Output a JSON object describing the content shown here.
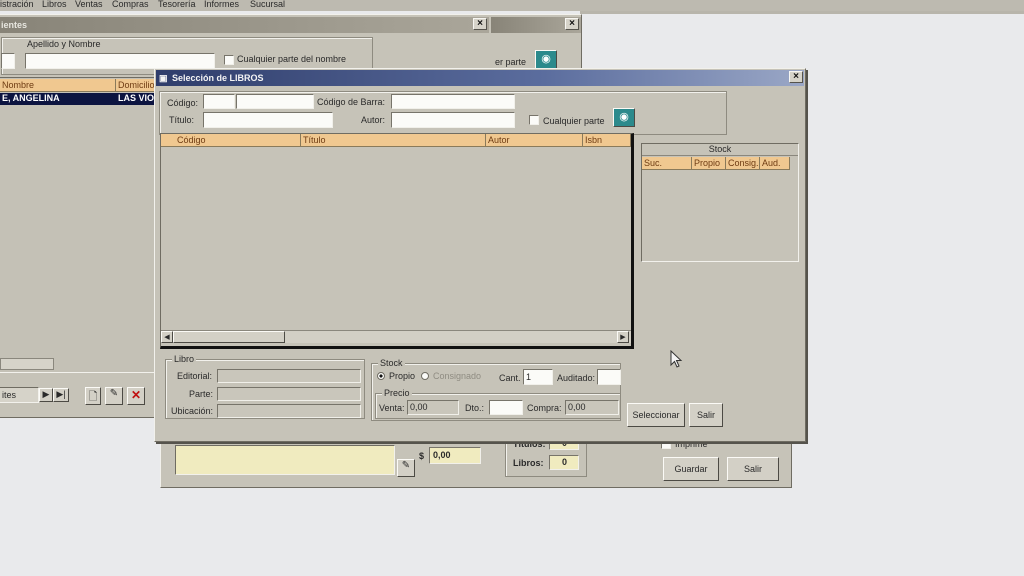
{
  "menubar": {
    "items": [
      "istración",
      "Libros",
      "Ventas",
      "Compras",
      "Tesorería",
      "Informes",
      "Sucursal"
    ]
  },
  "clientes_window": {
    "title": "ientes",
    "filter_label": "Apellido y Nombre",
    "any_part_label": "Cualquier parte del nombre",
    "any_part_label_right": "er parte",
    "columns": [
      "Nombre",
      "Domicilio"
    ],
    "row": {
      "nombre": "E, ANGELINA",
      "domicilio": "LAS VIO"
    },
    "footer_label": "ites"
  },
  "back_window": {
    "amount_prefix": "$",
    "amount_value": "0,00",
    "titulos_label": "Títulos:",
    "titulos_value": "0",
    "libros_label": "Libros:",
    "libros_value": "0",
    "imprime_label": "Imprime",
    "guardar_label": "Guardar",
    "salir_label": "Salir"
  },
  "dialog": {
    "title": "Selección de LIBROS",
    "search": {
      "codigo_label": "Código:",
      "codigo_barra_label": "Código de Barra:",
      "titulo_label": "Título:",
      "autor_label": "Autor:",
      "any_part_label": "Cualquier parte"
    },
    "grid_columns": [
      "Código",
      "Título",
      "Autor",
      "Isbn"
    ],
    "stock_panel": {
      "title": "Stock",
      "columns": [
        "Suc.",
        "Propio",
        "Consig.",
        "Aud."
      ]
    },
    "libro_group": {
      "legend": "Libro",
      "editorial_label": "Editorial:",
      "parte_label": "Parte:",
      "ubicacion_label": "Ubicación:"
    },
    "stock_group": {
      "legend": "Stock",
      "propio_label": "Propio",
      "consignado_label": "Consignado",
      "cant_label": "Cant.",
      "cant_value": "1",
      "auditado_label": "Auditado:",
      "precio_legend": "Precio",
      "venta_label": "Venta:",
      "venta_value": "0,00",
      "dto_label": "Dto.:",
      "compra_label": "Compra:",
      "compra_value": "0,00"
    },
    "seleccionar_label": "Seleccionar",
    "salir_label": "Salir"
  },
  "colors": {
    "header_orange": "#f0c890",
    "window_face": "#c6c3b8",
    "titlebar_active": "#2f3d6b",
    "selected_row": "#0c1440"
  }
}
